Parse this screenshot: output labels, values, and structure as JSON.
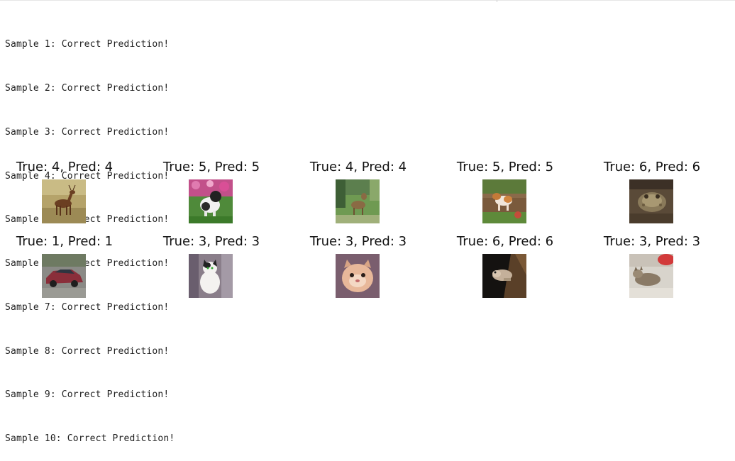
{
  "output": {
    "lines": [
      "Sample 1: Correct Prediction!",
      "Sample 2: Correct Prediction!",
      "Sample 3: Correct Prediction!",
      "Sample 4: Correct Prediction!",
      "Sample 5: Correct Prediction!",
      "Sample 6: Correct Prediction!",
      "Sample 7: Correct Prediction!",
      "Sample 8: Correct Prediction!",
      "Sample 9: Correct Prediction!",
      "Sample 10: Correct Prediction!"
    ]
  },
  "samples": [
    {
      "title": "True: 4, Pred: 4",
      "image": "deer-photo-icon"
    },
    {
      "title": "True: 5, Pred: 5",
      "image": "dog-flowers-photo-icon"
    },
    {
      "title": "True: 4, Pred: 4",
      "image": "deer-grass-photo-icon"
    },
    {
      "title": "True: 5, Pred: 5",
      "image": "dog-running-photo-icon"
    },
    {
      "title": "True: 6, Pred: 6",
      "image": "frog-photo-icon"
    },
    {
      "title": "True: 1, Pred: 1",
      "image": "car-photo-icon"
    },
    {
      "title": "True: 3, Pred: 3",
      "image": "cat-sitting-photo-icon"
    },
    {
      "title": "True: 3, Pred: 3",
      "image": "cat-face-photo-icon"
    },
    {
      "title": "True: 6, Pred: 6",
      "image": "frog-dark-photo-icon"
    },
    {
      "title": "True: 3, Pred: 3",
      "image": "cat-lying-photo-icon"
    }
  ],
  "colors": {
    "text": "#1f1f1f",
    "background": "#ffffff"
  }
}
